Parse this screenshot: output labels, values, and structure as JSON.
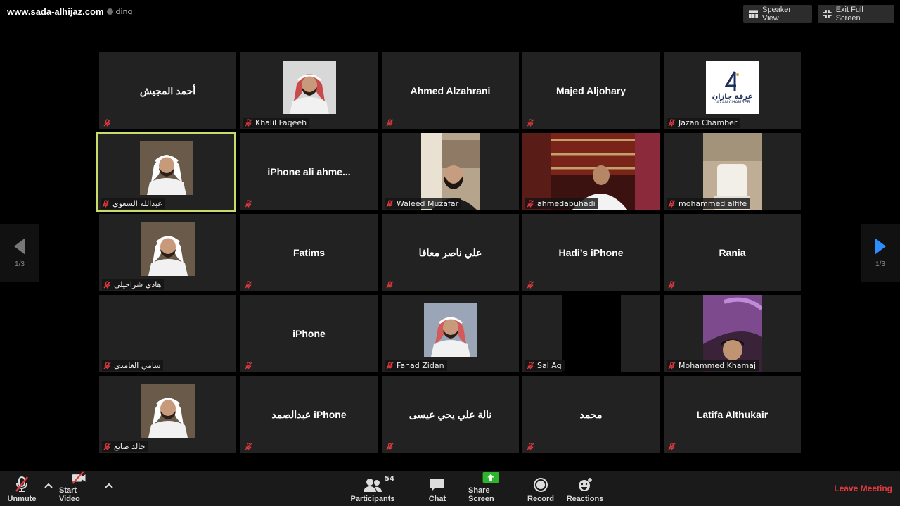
{
  "watermark": "www.sada-alhijaz.com",
  "recording_text": "ding",
  "top_buttons": {
    "speaker_view": "Speaker View",
    "exit_full_screen": "Exit Full Screen"
  },
  "pagination": {
    "left": "1/3",
    "right": "1/3"
  },
  "tiles": [
    {
      "name": "أحمد المجيش",
      "label": "",
      "kind": "name"
    },
    {
      "name": "",
      "label": "Khalil Faqeeh",
      "kind": "photo"
    },
    {
      "name": "Ahmed Alzahrani",
      "label": "",
      "kind": "name"
    },
    {
      "name": "Majed Aljohary",
      "label": "",
      "kind": "name"
    },
    {
      "name": "",
      "label": "Jazan Chamber",
      "kind": "logo",
      "logo_text": "غرفة جازان",
      "logo_sub": "JAZAN CHAMBER"
    },
    {
      "name": "",
      "label": "عبدالله السعوي",
      "kind": "photo",
      "active": true
    },
    {
      "name": "iPhone ali ahme...",
      "label": "",
      "kind": "name"
    },
    {
      "name": "",
      "label": "Waleed Muzafar",
      "kind": "video"
    },
    {
      "name": "",
      "label": "ahmedabuhadi",
      "kind": "video-full"
    },
    {
      "name": "",
      "label": "mohammed alfife",
      "kind": "video"
    },
    {
      "name": "",
      "label": "هادي شراحيلي",
      "kind": "photo"
    },
    {
      "name": "Fatims",
      "label": "",
      "kind": "name"
    },
    {
      "name": "علي ناصر معافا",
      "label": "",
      "kind": "name"
    },
    {
      "name": "Hadi’s iPhone",
      "label": "",
      "kind": "name"
    },
    {
      "name": "Rania",
      "label": "",
      "kind": "name"
    },
    {
      "name": "",
      "label": "سامي الغامدي",
      "kind": "empty"
    },
    {
      "name": "iPhone",
      "label": "",
      "kind": "name"
    },
    {
      "name": "",
      "label": "Fahad Zidan",
      "kind": "photo"
    },
    {
      "name": "",
      "label": "Sal Aq",
      "kind": "black"
    },
    {
      "name": "",
      "label": "Mohammed Khamaj",
      "kind": "video"
    },
    {
      "name": "",
      "label": "خالد صايغ",
      "kind": "photo"
    },
    {
      "name": "iPhone عبدالصمد",
      "label": "",
      "kind": "name"
    },
    {
      "name": "نالة علي يحي عيسى",
      "label": "",
      "kind": "name"
    },
    {
      "name": "محمد",
      "label": "",
      "kind": "name"
    },
    {
      "name": "Latifa Althukair",
      "label": "",
      "kind": "name"
    }
  ],
  "toolbar": {
    "unmute": "Unmute",
    "start_video": "Start Video",
    "participants": "Participants",
    "participants_count": "54",
    "chat": "Chat",
    "share_screen": "Share Screen",
    "record": "Record",
    "reactions": "Reactions",
    "leave": "Leave Meeting"
  },
  "colors": {
    "leave": "#e0393e",
    "share": "#2db52d",
    "active_border": "#c9db6a",
    "tile_bg": "#222222"
  }
}
